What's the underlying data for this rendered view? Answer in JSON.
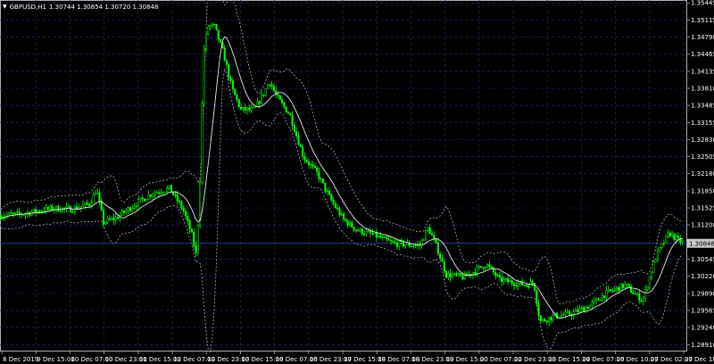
{
  "header": {
    "menu_icon": "triangle-down-icon",
    "symbol": "GBPUSD,H1",
    "ohlc": "1.30744 1.30854 1.30720 1.30848"
  },
  "colors": {
    "background": "#000000",
    "candle": "#00ff00",
    "ma_line": "#ffffff",
    "envelope": "#c0c0c0",
    "grid": "#1a2a6c",
    "current_price_line": "#3050b0",
    "price_tag": "#c8c8c8"
  },
  "chart_data": {
    "type": "candlestick",
    "symbol": "GBPUSD",
    "timeframe": "H1",
    "title": "GBPUSD,H1",
    "current_price": 1.30848,
    "ylim": [
      1.2878,
      1.355
    ],
    "y_ticks": [
      "1.35445",
      "1.35115",
      "1.34790",
      "1.34465",
      "1.34135",
      "1.33810",
      "1.33485",
      "1.33155",
      "1.32830",
      "1.32505",
      "1.32180",
      "1.31850",
      "1.31525",
      "1.31200",
      "1.30848",
      "1.30545",
      "1.30220",
      "1.29890",
      "1.29565",
      "1.29240",
      "1.28910"
    ],
    "x_ticks": [
      "8 Dec 2019",
      "9 Dec 15:00",
      "10 Dec 07:00",
      "10 Dec 23:00",
      "11 Dec 15:00",
      "12 Dec 07:00",
      "12 Dec 23:00",
      "13 Dec 15:00",
      "16 Dec 07:00",
      "16 Dec 23:00",
      "17 Dec 15:00",
      "18 Dec 07:00",
      "18 Dec 23:00",
      "19 Dec 15:00",
      "20 Dec 07:00",
      "22 Dec 23:00",
      "23 Dec 15:00",
      "24 Dec 07:00",
      "26 Dec 10:00",
      "27 Dec 02:00",
      "27 Dec 18:00"
    ],
    "price_path": [
      [
        0,
        1.3138
      ],
      [
        20,
        1.314
      ],
      [
        40,
        1.3146
      ],
      [
        60,
        1.3152
      ],
      [
        80,
        1.315
      ],
      [
        100,
        1.316
      ],
      [
        108,
        1.3188
      ],
      [
        116,
        1.3125
      ],
      [
        130,
        1.3133
      ],
      [
        150,
        1.3158
      ],
      [
        170,
        1.318
      ],
      [
        190,
        1.319
      ],
      [
        205,
        1.315
      ],
      [
        215,
        1.31
      ],
      [
        220,
        1.306
      ],
      [
        224,
        1.32
      ],
      [
        228,
        1.345
      ],
      [
        233,
        1.35
      ],
      [
        240,
        1.35
      ],
      [
        250,
        1.345
      ],
      [
        260,
        1.338
      ],
      [
        270,
        1.334
      ],
      [
        285,
        1.334
      ],
      [
        295,
        1.337
      ],
      [
        302,
        1.3395
      ],
      [
        310,
        1.3365
      ],
      [
        325,
        1.333
      ],
      [
        340,
        1.325
      ],
      [
        355,
        1.322
      ],
      [
        370,
        1.317
      ],
      [
        385,
        1.313
      ],
      [
        400,
        1.311
      ],
      [
        420,
        1.31
      ],
      [
        440,
        1.3085
      ],
      [
        470,
        1.308
      ],
      [
        480,
        1.3115
      ],
      [
        490,
        1.3075
      ],
      [
        500,
        1.3025
      ],
      [
        520,
        1.302
      ],
      [
        545,
        1.3045
      ],
      [
        560,
        1.3015
      ],
      [
        575,
        1.301
      ],
      [
        590,
        1.3005
      ],
      [
        598,
        1.301
      ],
      [
        605,
        1.2935
      ],
      [
        620,
        1.2945
      ],
      [
        640,
        1.295
      ],
      [
        660,
        1.2965
      ],
      [
        680,
        1.299
      ],
      [
        700,
        1.3005
      ],
      [
        720,
        1.2975
      ],
      [
        735,
        1.306
      ],
      [
        750,
        1.3105
      ],
      [
        760,
        1.309
      ],
      [
        768,
        1.3085
      ]
    ],
    "ma_period": "envelope",
    "grid": true,
    "legend": "none"
  }
}
